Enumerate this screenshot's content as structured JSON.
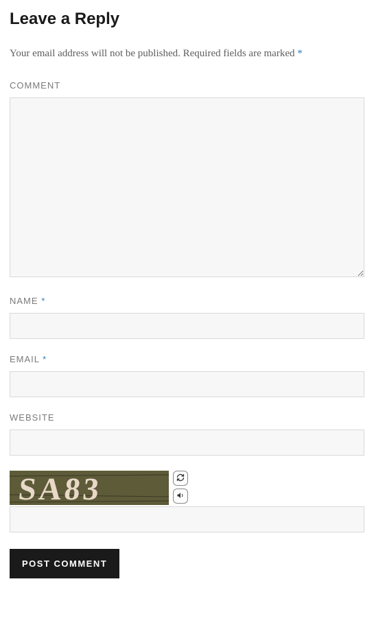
{
  "heading": "Leave a Reply",
  "notice": {
    "text_before": "Your email address will not be published.",
    "text_required": "Required fields are marked",
    "asterisk": "*"
  },
  "fields": {
    "comment": {
      "label": "COMMENT"
    },
    "name": {
      "label": "NAME",
      "asterisk": "*"
    },
    "email": {
      "label": "EMAIL",
      "asterisk": "*"
    },
    "website": {
      "label": "WEBSITE"
    }
  },
  "captcha": {
    "text": "SA83"
  },
  "submit": {
    "label": "POST COMMENT"
  }
}
